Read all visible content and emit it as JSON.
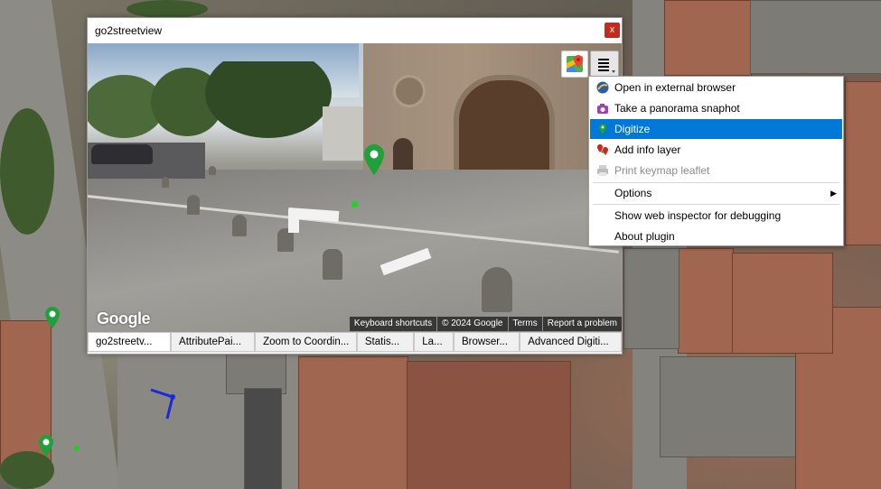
{
  "window": {
    "title": "go2streetview",
    "close_label": "x"
  },
  "streetview": {
    "logo": "Google",
    "credits": [
      "Keyboard shortcuts",
      "© 2024 Google",
      "Terms",
      "Report a problem"
    ]
  },
  "tabs": [
    {
      "label": "go2streetv...",
      "active": true
    },
    {
      "label": "AttributePai...",
      "active": false
    },
    {
      "label": "Zoom to Coordin...",
      "active": false
    },
    {
      "label": "Statis...",
      "active": false
    },
    {
      "label": "La...",
      "active": false
    },
    {
      "label": "Browser...",
      "active": false
    },
    {
      "label": "Advanced Digiti...",
      "active": false
    }
  ],
  "menu": {
    "items": [
      {
        "label": "Open in external browser",
        "icon": "browser-icon",
        "state": "normal"
      },
      {
        "label": "Take a panorama snaphot",
        "icon": "camera-icon",
        "state": "normal"
      },
      {
        "label": "Digitize",
        "icon": "map-pin-icon",
        "state": "selected"
      },
      {
        "label": "Add info layer",
        "icon": "info-layer-icon",
        "state": "normal"
      },
      {
        "label": "Print keymap leaflet",
        "icon": "printer-icon",
        "state": "disabled"
      },
      {
        "label": "Options",
        "icon": "",
        "state": "normal",
        "submenu": true
      },
      {
        "label": "Show web inspector for debugging",
        "icon": "",
        "state": "normal"
      },
      {
        "label": "About plugin",
        "icon": "",
        "state": "normal"
      }
    ],
    "submenu_arrow": "▶"
  },
  "colors": {
    "selection": "#0078d7",
    "close": "#c42b1c",
    "marker": "#1fa03a"
  }
}
